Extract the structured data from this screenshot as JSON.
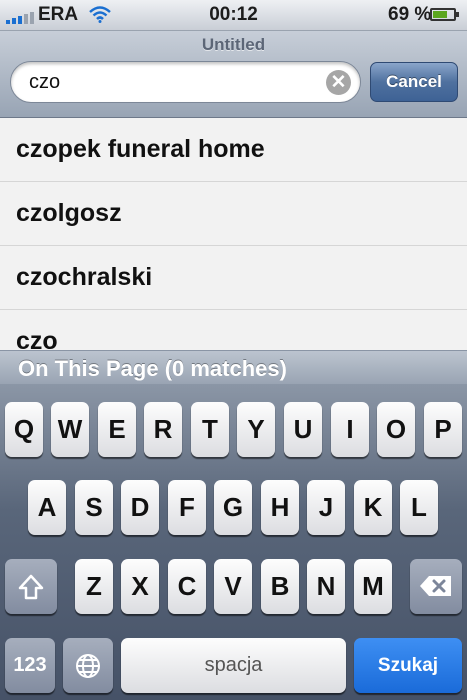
{
  "status": {
    "carrier": "ERA",
    "time": "00:12",
    "battery": "69 %",
    "battery_level": 0.69
  },
  "title": "Untitled",
  "search": {
    "value": "czo"
  },
  "cancel_label": "Cancel",
  "suggestions": [
    "czopek funeral home",
    "czolgosz",
    "czochralski",
    "czo"
  ],
  "find_bar": "On This Page (0 matches)",
  "keyboard": {
    "row1": [
      "Q",
      "W",
      "E",
      "R",
      "T",
      "Y",
      "U",
      "I",
      "O",
      "P"
    ],
    "row2": [
      "A",
      "S",
      "D",
      "F",
      "G",
      "H",
      "J",
      "K",
      "L"
    ],
    "row3": [
      "Z",
      "X",
      "C",
      "V",
      "B",
      "N",
      "M"
    ],
    "numbers_label": "123",
    "space_label": "spacja",
    "search_label": "Szukaj"
  },
  "icons": {
    "shift": "shift-icon",
    "delete": "delete-icon",
    "globe": "globe-icon",
    "clear": "clear-icon",
    "wifi": "wifi-icon"
  }
}
